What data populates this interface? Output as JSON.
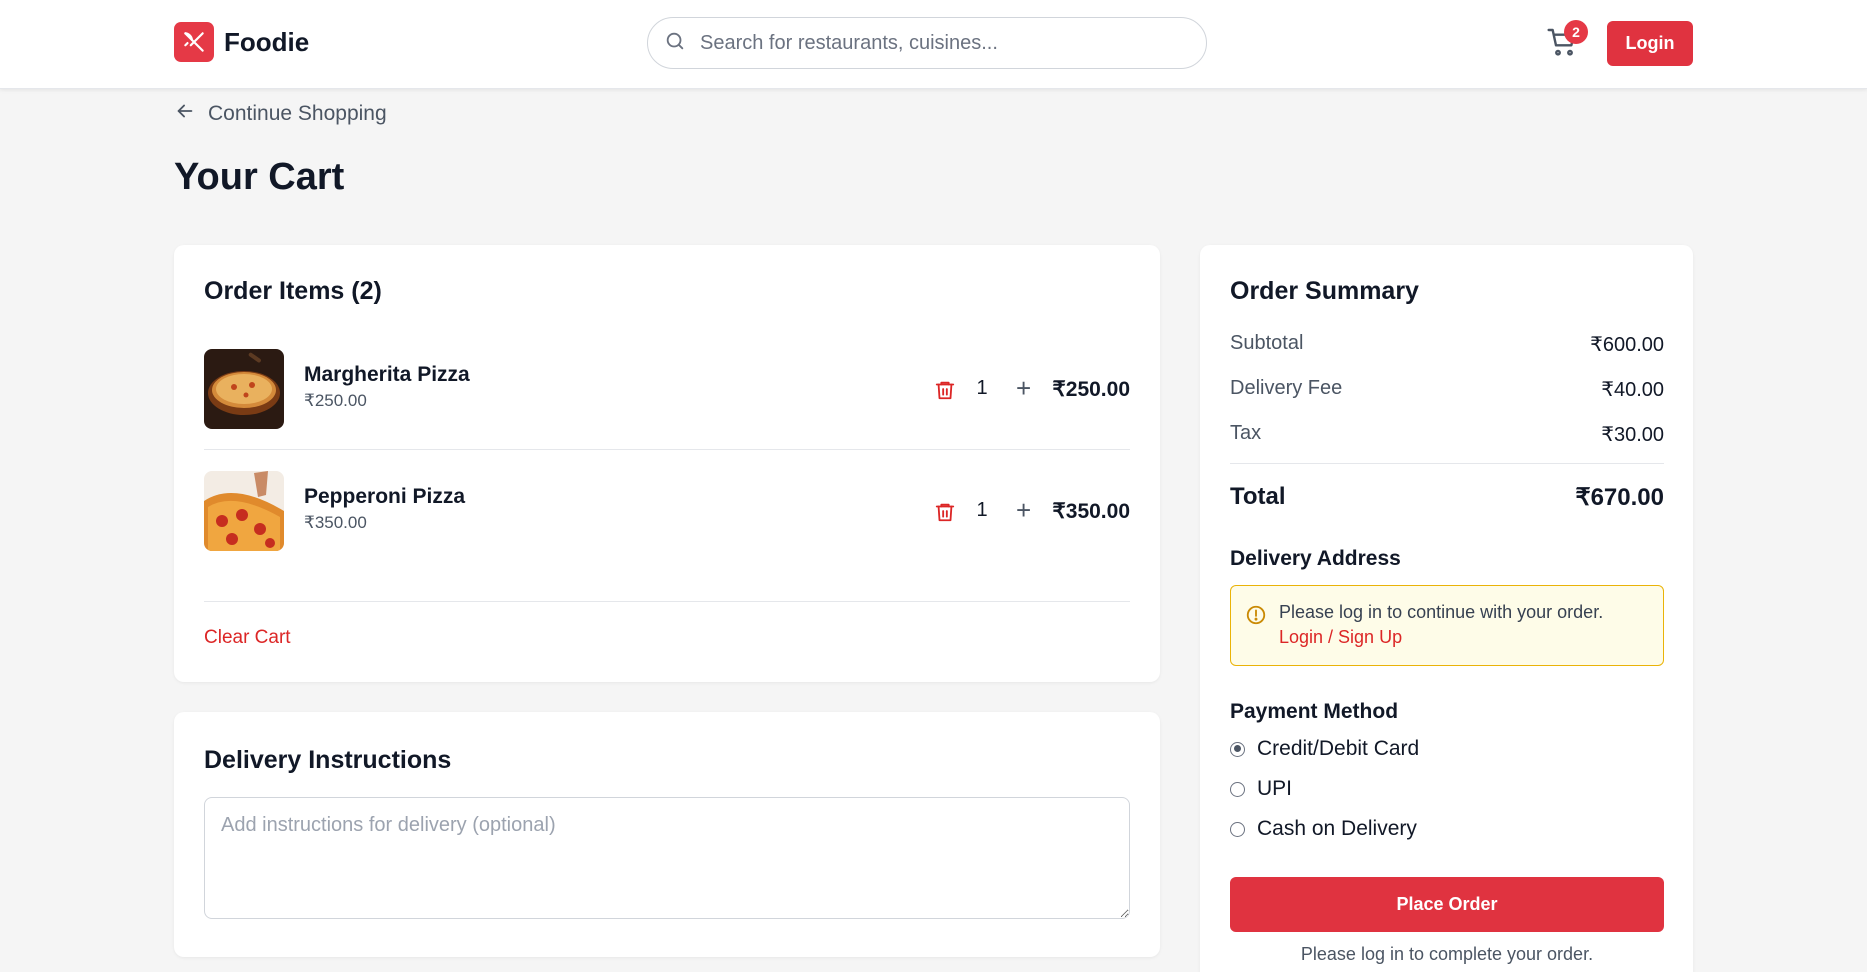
{
  "header": {
    "brand": "Foodie",
    "search_placeholder": "Search for restaurants, cuisines...",
    "cart_count": "2",
    "login_label": "Login"
  },
  "nav": {
    "back_label": "Continue Shopping"
  },
  "page": {
    "title": "Your Cart"
  },
  "order_items": {
    "title": "Order Items (2)",
    "items": [
      {
        "name": "Margherita Pizza",
        "unit_price": "₹250.00",
        "quantity": "1",
        "line_total": "₹250.00"
      },
      {
        "name": "Pepperoni Pizza",
        "unit_price": "₹350.00",
        "quantity": "1",
        "line_total": "₹350.00"
      }
    ],
    "clear_label": "Clear Cart"
  },
  "delivery_instructions": {
    "title": "Delivery Instructions",
    "placeholder": "Add instructions for delivery (optional)"
  },
  "summary": {
    "title": "Order Summary",
    "subtotal_label": "Subtotal",
    "subtotal_value": "₹600.00",
    "delivery_label": "Delivery Fee",
    "delivery_value": "₹40.00",
    "tax_label": "Tax",
    "tax_value": "₹30.00",
    "total_label": "Total",
    "total_value": "₹670.00",
    "address_label": "Delivery Address",
    "alert_text": "Please log in to continue with your order.",
    "alert_link": "Login / Sign Up",
    "payment_label": "Payment Method",
    "payment_options": [
      "Credit/Debit Card",
      "UPI",
      "Cash on Delivery"
    ],
    "payment_selected": "Credit/Debit Card",
    "place_order_label": "Place Order",
    "login_note": "Please log in to complete your order."
  },
  "colors": {
    "accent": "#e03340",
    "alert_bg": "#fefce8",
    "alert_border": "#eab308"
  },
  "icons": [
    "fork-knife-icon",
    "search-icon",
    "cart-icon",
    "arrow-left-icon",
    "trash-icon",
    "plus-icon",
    "warning-icon"
  ]
}
